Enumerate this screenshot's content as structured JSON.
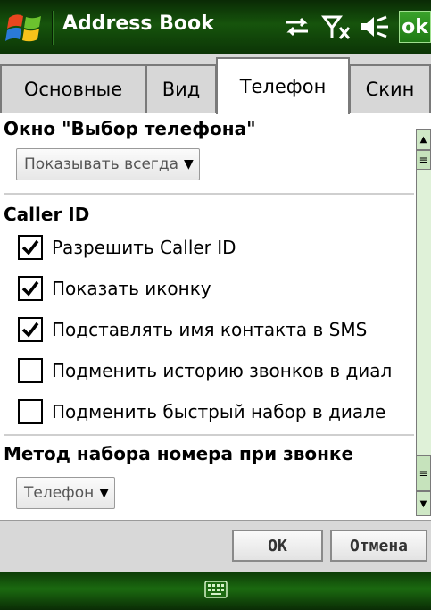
{
  "app": {
    "title": "Address Book"
  },
  "status_bar": {
    "icons": [
      "connectivity-arrows-icon",
      "signal-no-service-icon",
      "speaker-muted-icon"
    ],
    "ok_label": "ok"
  },
  "tabs": [
    {
      "label": "Основные",
      "active": false
    },
    {
      "label": "Вид",
      "active": false
    },
    {
      "label": "Телефон",
      "active": true
    },
    {
      "label": "Скин",
      "active": false
    }
  ],
  "phone_picker": {
    "title": "Окно \"Выбор телефона\"",
    "dropdown_value": "Показывать всегда"
  },
  "caller_id": {
    "title": "Caller ID",
    "options": [
      {
        "label": "Разрешить Caller ID",
        "checked": true
      },
      {
        "label": "Показать иконку",
        "checked": true
      },
      {
        "label": "Подставлять имя контакта в SMS",
        "checked": true
      },
      {
        "label": "Подменить историю звонков в диал",
        "checked": false
      },
      {
        "label": "Подменить быстрый набор в диале",
        "checked": false
      }
    ]
  },
  "dial_method": {
    "title": "Метод набора номера при звонке",
    "dropdown_value": "Телефон"
  },
  "buttons": {
    "ok": "OK",
    "cancel": "Отмена"
  },
  "colors": {
    "titlebar": "#16540c",
    "scrollbar": "#dff1d8",
    "ok_button": "#2a8f1f"
  }
}
